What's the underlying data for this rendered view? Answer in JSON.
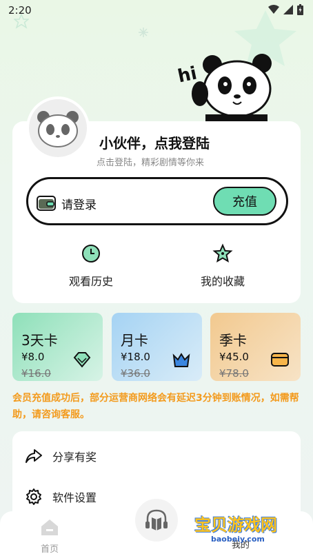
{
  "status": {
    "time": "2:20"
  },
  "hero": {
    "hi": "hi"
  },
  "profile": {
    "title": "小伙伴，点我登陆",
    "subtitle": "点击登陆，精彩剧情等你来",
    "wallet_label": "请登录",
    "recharge_label": "充值"
  },
  "quick_actions": [
    {
      "label": "观看历史",
      "icon": "history-clock-icon"
    },
    {
      "label": "我的收藏",
      "icon": "star-icon"
    }
  ],
  "vip_cards": [
    {
      "name": "3天卡",
      "price": "¥8.0",
      "original": "¥16.0",
      "icon": "diamond-icon",
      "color_from": "#8ee0b9",
      "color_to": "#d7f3e6"
    },
    {
      "name": "月卡",
      "price": "¥18.0",
      "original": "¥36.0",
      "icon": "crown-icon",
      "color_from": "#a5d3f3",
      "color_to": "#d9ecf8"
    },
    {
      "name": "季卡",
      "price": "¥45.0",
      "original": "¥78.0",
      "icon": "card-icon",
      "color_from": "#f2c98f",
      "color_to": "#f7e3c6"
    }
  ],
  "notice": "会员充值成功后，部分运营商网络会有延迟3分钟到账情况，如需帮助，请咨询客服。",
  "menu": [
    {
      "label": "分享有奖",
      "icon": "share-icon"
    },
    {
      "label": "软件设置",
      "icon": "settings-gear-icon"
    }
  ],
  "nav": {
    "home": "首页",
    "mine": "我的"
  },
  "watermark": {
    "title": "宝贝游戏网",
    "url": "baobeiy.com"
  }
}
